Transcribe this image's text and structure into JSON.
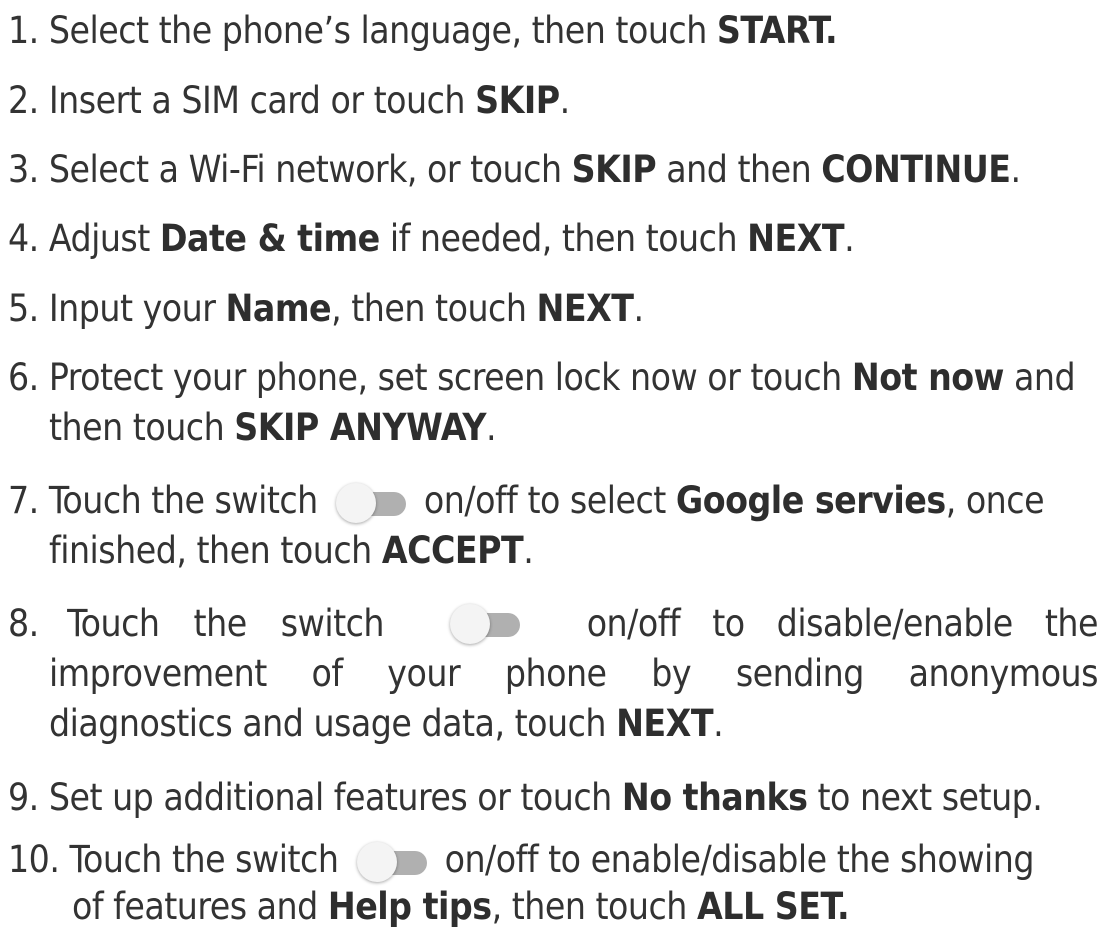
{
  "steps": [
    {
      "num": "1.",
      "t1": "Select the phone’s language,  then touch ",
      "b1": "START."
    },
    {
      "num": "2.",
      "t1": "Insert a SIM card or touch ",
      "b1": "SKIP",
      "t2": "."
    },
    {
      "num": "3.",
      "t1": "Select a Wi-Fi network, or touch ",
      "b1": "SKIP",
      "t2": " and then ",
      "b2": "CONTINUE",
      "t3": "."
    },
    {
      "num": "4.",
      "t1": "Adjust ",
      "b1": "Date & time",
      "t2": " if needed, then touch ",
      "b2": "NEXT",
      "t3": "."
    },
    {
      "num": "5.",
      "t1": "Input your ",
      "b1": "Name",
      "t2": ", then touch ",
      "b2": "NEXT",
      "t3": "."
    },
    {
      "num": "6.",
      "t1": "Protect your phone, set screen lock now or touch ",
      "b1": "Not now",
      "t2": " and",
      "t3": "then touch ",
      "b2": "SKIP ANYWAY",
      "t4": "."
    },
    {
      "num": "7.",
      "t1": "Touch the switch ",
      "t2": " on/off to select ",
      "b1": "Google servies",
      "t3": ", once",
      "t4": "finished, then touch ",
      "b2": "ACCEPT",
      "t5": "."
    },
    {
      "num": "8.",
      "t1": "Touch the switch",
      "t2": "on/off to disable/enable the",
      "t3": "improvement of your phone by sending anonymous",
      "t4": "diagnostics and usage data, touch ",
      "b1": "NEXT",
      "t5": "."
    },
    {
      "num": "9.",
      "t1": "Set up additional features or touch ",
      "b1": "No thanks",
      "t2": " to next setup."
    },
    {
      "num": "10.",
      "t1": "Touch the switch ",
      "t2": " on/off to enable/disable the showing",
      "t3": "of features and ",
      "b1": "Help tips",
      "t4": ", then touch ",
      "b2": "ALL SET."
    }
  ]
}
